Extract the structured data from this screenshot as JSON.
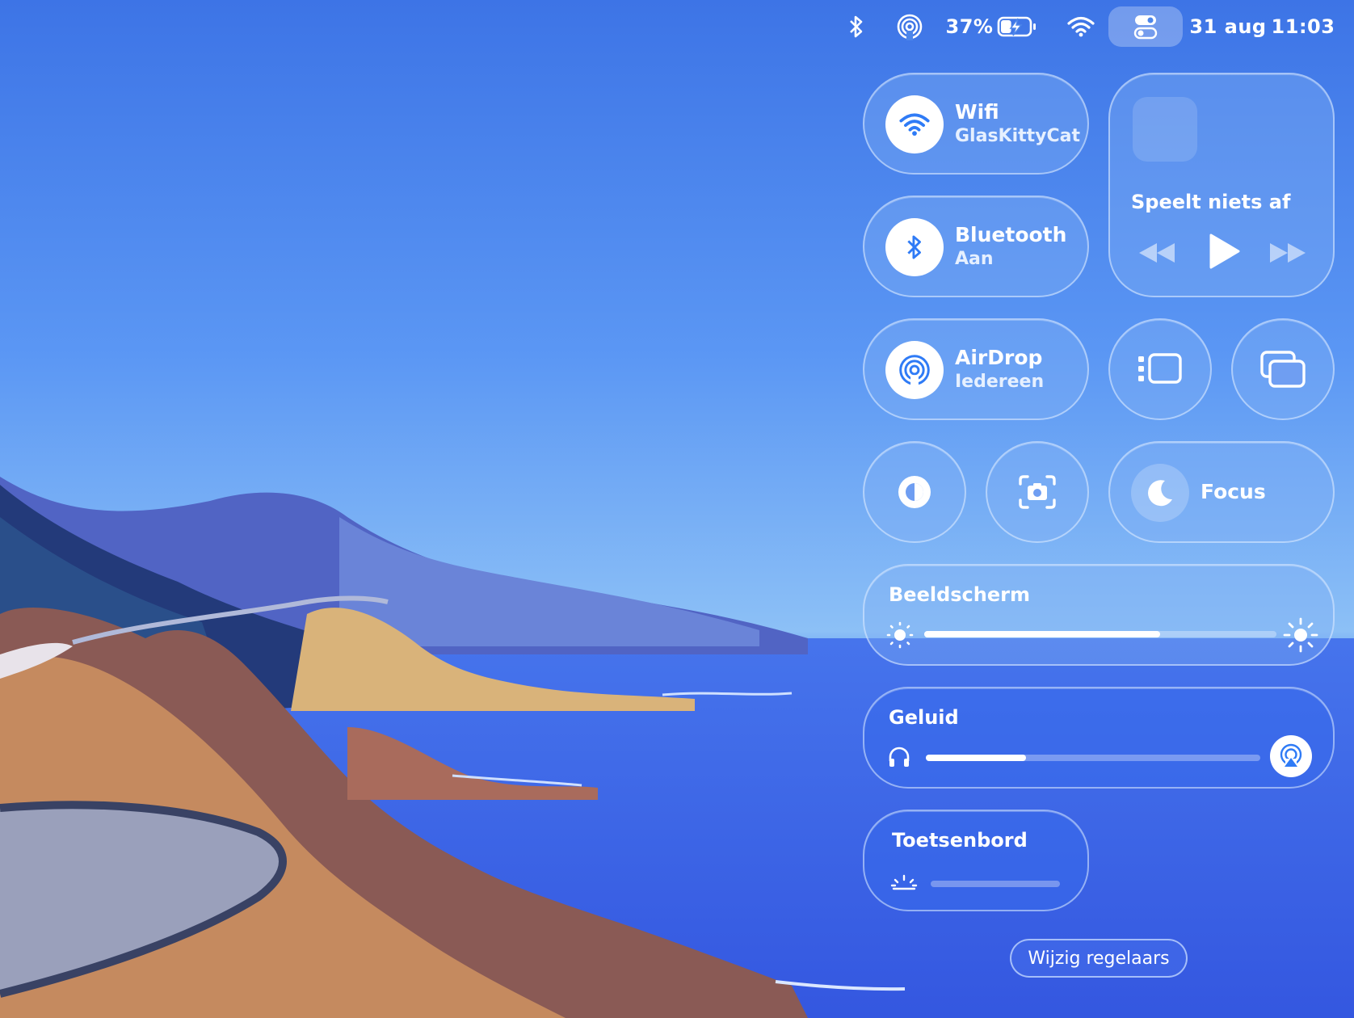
{
  "menubar": {
    "icons": [
      "bluetooth-icon",
      "airdrop-icon",
      "battery-charging-icon",
      "wifi-icon",
      "control-center-icon"
    ],
    "battery_percent": "37%",
    "battery_level": 0.37,
    "date": "31 aug",
    "time": "11:03"
  },
  "control_center": {
    "wifi": {
      "title": "Wifi",
      "subtitle": "GlasKittyCat"
    },
    "bluetooth": {
      "title": "Bluetooth",
      "subtitle": "Aan"
    },
    "airdrop": {
      "title": "AirDrop",
      "subtitle": "Iedereen"
    },
    "now_playing": {
      "status": "Speelt niets af"
    },
    "focus": {
      "label": "Focus"
    },
    "display": {
      "title": "Beeldscherm",
      "brightness": 0.67
    },
    "sound": {
      "title": "Geluid",
      "volume": 0.3
    },
    "keyboard": {
      "title": "Toetsenbord",
      "backlight": 0.0
    },
    "edit_button": "Wijzig regelaars"
  },
  "colors": {
    "accent": "#2f7bf6",
    "tile_bg": "#82aff5"
  }
}
